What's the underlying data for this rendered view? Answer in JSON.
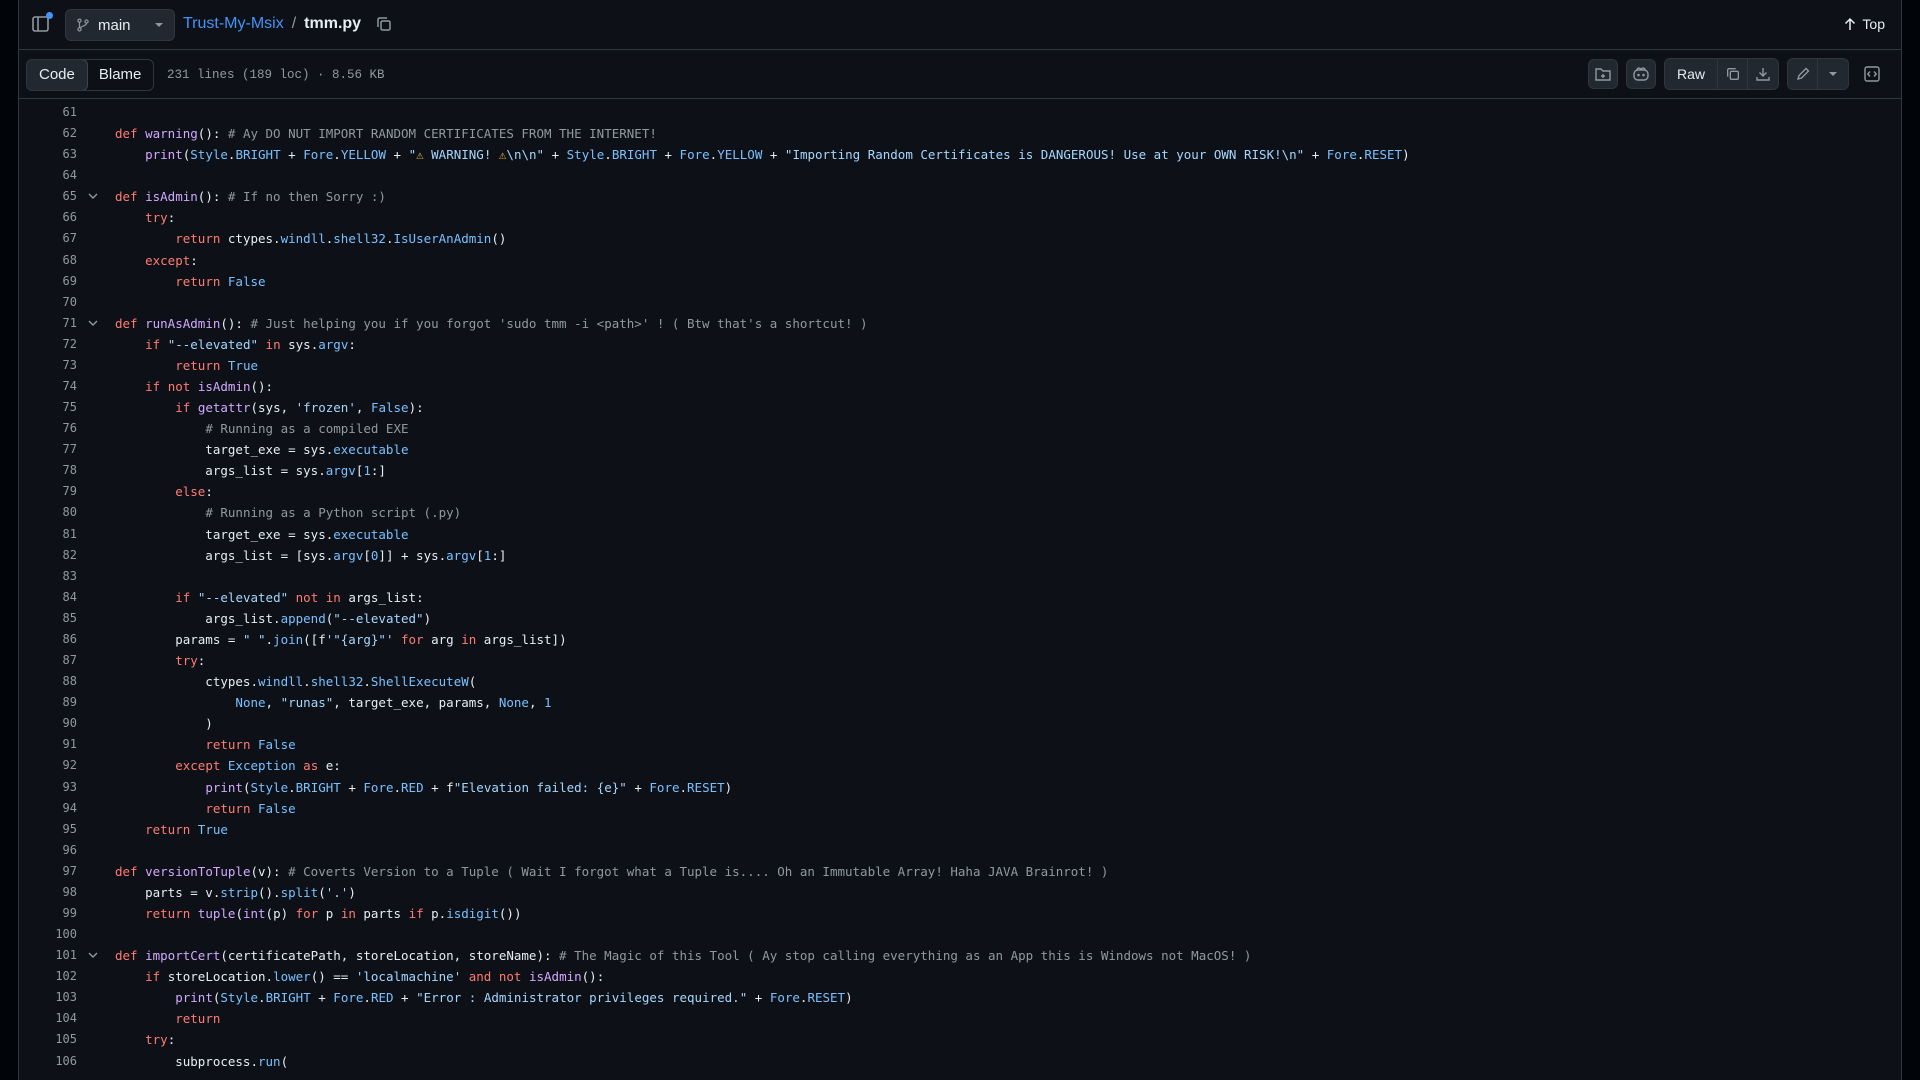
{
  "header": {
    "branch": "main",
    "repo": "Trust-My-Msix",
    "separator": "/",
    "file": "tmm.py",
    "top_label": "Top"
  },
  "toolbar": {
    "tab_code": "Code",
    "tab_blame": "Blame",
    "file_info": "231 lines (189 loc) · 8.56 KB",
    "raw_label": "Raw"
  },
  "code": {
    "lines": [
      {
        "n": "61",
        "t": ""
      },
      {
        "n": "62",
        "t": "def warning(): # Ay DO NUT IMPORT RANDOM CERTIFICATES FROM THE INTERNET!",
        "fold": false
      },
      {
        "n": "63",
        "t": "    print(Style.BRIGHT + Fore.YELLOW + \"⚠ WARNING! ⚠\\n\\n\" + Style.BRIGHT + Fore.YELLOW + \"Importing Random Certificates is DANGEROUS! Use at your OWN RISK!\\n\" + Fore.RESET)"
      },
      {
        "n": "64",
        "t": ""
      },
      {
        "n": "65",
        "t": "def isAdmin(): # If no then Sorry :)",
        "fold": true
      },
      {
        "n": "66",
        "t": "    try:"
      },
      {
        "n": "67",
        "t": "        return ctypes.windll.shell32.IsUserAnAdmin()"
      },
      {
        "n": "68",
        "t": "    except:"
      },
      {
        "n": "69",
        "t": "        return False"
      },
      {
        "n": "70",
        "t": ""
      },
      {
        "n": "71",
        "t": "def runAsAdmin(): # Just helping you if you forgot 'sudo tmm -i <path>' ! ( Btw that's a shortcut! )",
        "fold": true
      },
      {
        "n": "72",
        "t": "    if \"--elevated\" in sys.argv:"
      },
      {
        "n": "73",
        "t": "        return True"
      },
      {
        "n": "74",
        "t": "    if not isAdmin():"
      },
      {
        "n": "75",
        "t": "        if getattr(sys, 'frozen', False):"
      },
      {
        "n": "76",
        "t": "            # Running as a compiled EXE"
      },
      {
        "n": "77",
        "t": "            target_exe = sys.executable"
      },
      {
        "n": "78",
        "t": "            args_list = sys.argv[1:]"
      },
      {
        "n": "79",
        "t": "        else:"
      },
      {
        "n": "80",
        "t": "            # Running as a Python script (.py)"
      },
      {
        "n": "81",
        "t": "            target_exe = sys.executable"
      },
      {
        "n": "82",
        "t": "            args_list = [sys.argv[0]] + sys.argv[1:]"
      },
      {
        "n": "83",
        "t": ""
      },
      {
        "n": "84",
        "t": "        if \"--elevated\" not in args_list:"
      },
      {
        "n": "85",
        "t": "            args_list.append(\"--elevated\")"
      },
      {
        "n": "86",
        "t": "        params = \" \".join([f'\"{arg}\"' for arg in args_list])"
      },
      {
        "n": "87",
        "t": "        try:"
      },
      {
        "n": "88",
        "t": "            ctypes.windll.shell32.ShellExecuteW("
      },
      {
        "n": "89",
        "t": "                None, \"runas\", target_exe, params, None, 1"
      },
      {
        "n": "90",
        "t": "            )"
      },
      {
        "n": "91",
        "t": "            return False"
      },
      {
        "n": "92",
        "t": "        except Exception as e:"
      },
      {
        "n": "93",
        "t": "            print(Style.BRIGHT + Fore.RED + f\"Elevation failed: {e}\" + Fore.RESET)"
      },
      {
        "n": "94",
        "t": "            return False"
      },
      {
        "n": "95",
        "t": "    return True"
      },
      {
        "n": "96",
        "t": ""
      },
      {
        "n": "97",
        "t": "def versionToTuple(v): # Coverts Version to a Tuple ( Wait I forgot what a Tuple is.... Oh an Immutable Array! Haha JAVA Brainrot! )"
      },
      {
        "n": "98",
        "t": "    parts = v.strip().split('.')"
      },
      {
        "n": "99",
        "t": "    return tuple(int(p) for p in parts if p.isdigit())"
      },
      {
        "n": "100",
        "t": ""
      },
      {
        "n": "101",
        "t": "def importCert(certificatePath, storeLocation, storeName): # The Magic of this Tool ( Ay stop calling everything as an App this is Windows not MacOS! )",
        "fold": true
      },
      {
        "n": "102",
        "t": "    if storeLocation.lower() == 'localmachine' and not isAdmin():"
      },
      {
        "n": "103",
        "t": "        print(Style.BRIGHT + Fore.RED + \"Error : Administrator privileges required.\" + Fore.RESET)"
      },
      {
        "n": "104",
        "t": "        return"
      },
      {
        "n": "105",
        "t": "    try:"
      },
      {
        "n": "106",
        "t": "        subprocess.run("
      }
    ]
  },
  "colors": {
    "background": "#0d1117",
    "keyword": "#ff7b72",
    "function": "#d2a8ff",
    "constant": "#79c0ff",
    "string": "#a5d6ff",
    "comment": "#9198a1",
    "link": "#4493f8"
  },
  "icons": [
    "sidebar-panel-icon",
    "git-branch-icon",
    "chevron-down-icon",
    "copy-icon",
    "arrow-up-icon",
    "add-file-icon",
    "copilot-icon",
    "download-icon",
    "pencil-icon",
    "code-square-icon"
  ]
}
